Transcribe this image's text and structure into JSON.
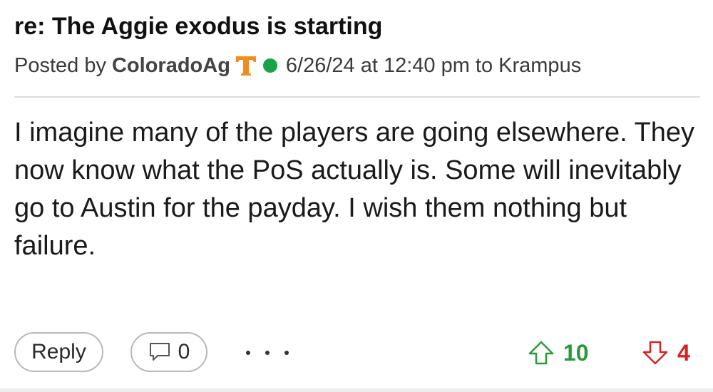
{
  "post": {
    "title": "re: The Aggie exodus is starting",
    "posted_by_label": "Posted by",
    "author": "ColoradoAg",
    "author_badge_icon": "tennessee-t-logo",
    "online_status_color": "#1aa34a",
    "timestamp": "6/26/24 at 12:40 pm",
    "to_label": "to Krampus",
    "body": "I imagine many of the players are going elsewhere. They now know what the PoS actually is. Some will inevitably go to Austin for the payday. I wish them nothing but failure."
  },
  "actions": {
    "reply_label": "Reply",
    "comment_count": "0",
    "more_icon": "more-dots-icon",
    "upvote_count": "10",
    "downvote_count": "4"
  },
  "colors": {
    "upvote": "#2a9a3c",
    "downvote": "#d42424",
    "badge_orange": "#f28c1e"
  }
}
